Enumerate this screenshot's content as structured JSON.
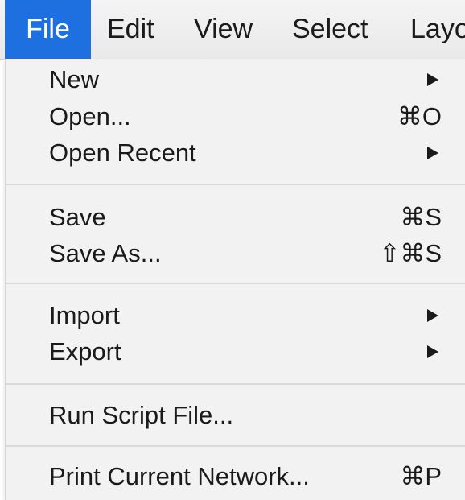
{
  "menubar": {
    "items": [
      "File",
      "Edit",
      "View",
      "Select",
      "Layo"
    ]
  },
  "file_menu": {
    "new": {
      "label": "New",
      "submenu_icon": "triangle-right-icon"
    },
    "open": {
      "label": "Open...",
      "shortcut": "⌘O"
    },
    "open_recent": {
      "label": "Open Recent",
      "submenu_icon": "triangle-right-icon"
    },
    "save": {
      "label": "Save",
      "shortcut": "⌘S"
    },
    "save_as": {
      "label": "Save As...",
      "shortcut": "⇧⌘S"
    },
    "import": {
      "label": "Import",
      "submenu_icon": "triangle-right-icon"
    },
    "export": {
      "label": "Export",
      "submenu_icon": "triangle-right-icon"
    },
    "run_script": {
      "label": "Run Script File..."
    },
    "print": {
      "label": "Print Current Network...",
      "shortcut": "⌘P"
    }
  },
  "colors": {
    "active_menu": "#1e6fe0",
    "menu_background": "#f2f2f2",
    "separator": "#d9d9d9"
  }
}
